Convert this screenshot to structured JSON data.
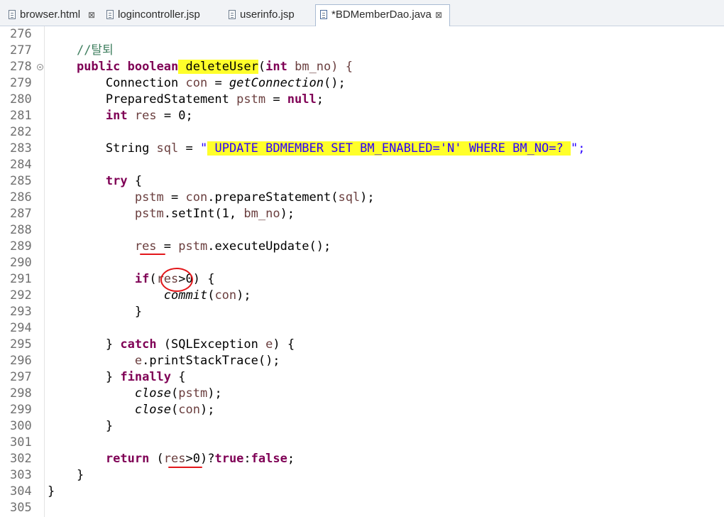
{
  "tabs": [
    {
      "label": "browser.html",
      "close": "⊠"
    },
    {
      "label": "logincontroller.jsp",
      "close": ""
    },
    {
      "label": "userinfo.jsp",
      "close": ""
    },
    {
      "label": "*BDMemberDao.java",
      "close": "⊠"
    }
  ],
  "line_numbers": [
    "276",
    "277",
    "278",
    "279",
    "280",
    "281",
    "282",
    "283",
    "284",
    "285",
    "286",
    "287",
    "288",
    "289",
    "290",
    "291",
    "292",
    "293",
    "294",
    "295",
    "296",
    "297",
    "298",
    "299",
    "300",
    "301",
    "302",
    "303",
    "304",
    "305"
  ],
  "code": {
    "comment": "//탈퇴",
    "kw_public": "public",
    "kw_boolean": "boolean",
    "method_name": "deleteUser",
    "paren_open": "(",
    "kw_int": "int",
    "param": " bm_no) {",
    "conn_type": "Connection ",
    "conn_var": "con",
    "eq": " = ",
    "get_conn": "getConnection",
    "call_end": "();",
    "ps_type": "PreparedStatement ",
    "ps_var": "pstm",
    "kw_null": "null",
    "semi": ";",
    "res_var": "res",
    "eq_zero": " = 0;",
    "string_type": "String ",
    "sql_var": "sql",
    "quote": "\"",
    "sql_body": " UPDATE BDMEMBER SET BM_ENABLED='N' WHERE BM_NO=? ",
    "quote_end": "\";",
    "kw_try": "try",
    "brace_open": " {",
    "prepare": ".prepareStatement(",
    "close_call": ");",
    "setint": ".setInt(1, ",
    "exec": ".executeUpdate();",
    "kw_if": "if",
    "gt0_brace": ">0) {",
    "commit": "commit",
    "paren_con_close": ");",
    "brace_close": "}",
    "brace_close_catch": "} ",
    "kw_catch": "catch",
    "catch_sig": " (SQLException ",
    "e_var": "e",
    "paren_brace": ") {",
    "print": ".printStackTrace();",
    "kw_finally": "finally",
    "close_fn": "close",
    "kw_return": "return",
    "ret_open": " (",
    "ret_gt": ">0)?",
    "kw_true": "true",
    "colon": ":",
    "kw_false": "false",
    "space": " "
  }
}
